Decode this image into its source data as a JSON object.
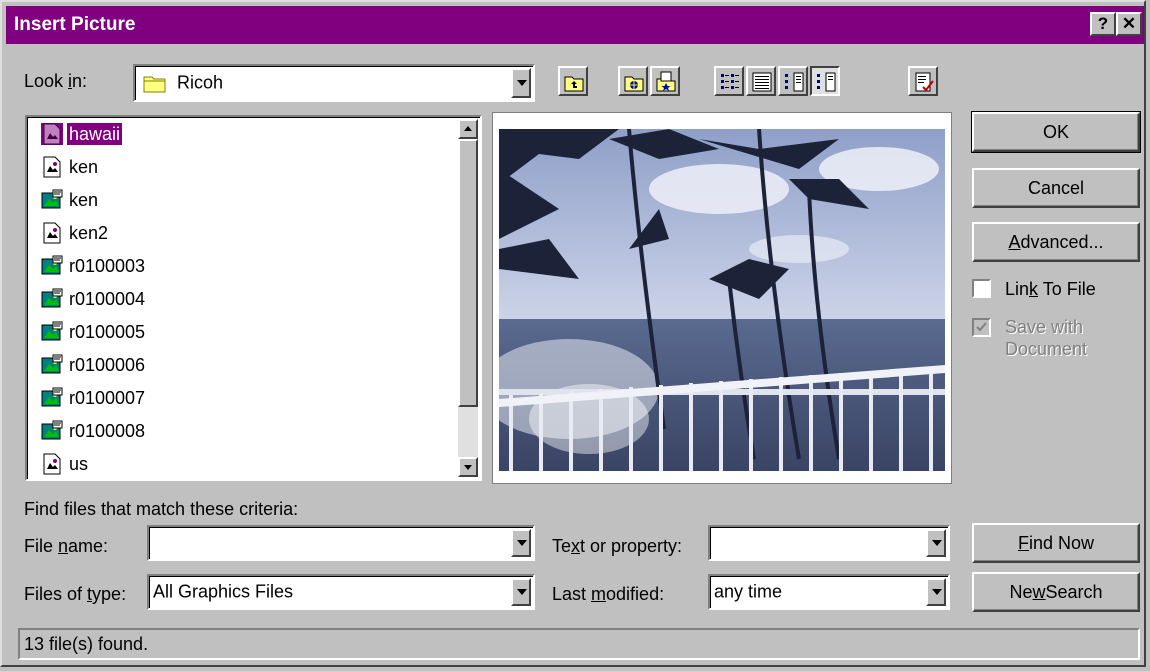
{
  "title": "Insert Picture",
  "titlebar_buttons": {
    "help": "?",
    "close": "✕"
  },
  "look_in": {
    "label_pre": "Look ",
    "label_u": "i",
    "label_post": "n:",
    "value": "Ricoh"
  },
  "toolbar": [
    "up-one-level-icon",
    "search-the-web-icon",
    "add-to-favorites-icon",
    "list-view-icon",
    "details-view-icon",
    "properties-view-icon",
    "preview-view-icon",
    "commands-and-settings-icon"
  ],
  "files": [
    {
      "name": "hawaii",
      "type": "picture",
      "selected": true
    },
    {
      "name": "ken",
      "type": "picture"
    },
    {
      "name": "ken",
      "type": "graphic"
    },
    {
      "name": "ken2",
      "type": "picture"
    },
    {
      "name": "r0100003",
      "type": "graphic"
    },
    {
      "name": "r0100004",
      "type": "graphic"
    },
    {
      "name": "r0100005",
      "type": "graphic"
    },
    {
      "name": "r0100006",
      "type": "graphic"
    },
    {
      "name": "r0100007",
      "type": "graphic"
    },
    {
      "name": "r0100008",
      "type": "graphic"
    },
    {
      "name": "us",
      "type": "picture"
    }
  ],
  "buttons": {
    "ok": "OK",
    "cancel": "Cancel",
    "advanced_u": "A",
    "advanced_rest": "dvanced...",
    "find_now_u": "F",
    "find_now_rest": "ind Now",
    "new_search_pre": "Ne",
    "new_search_u": "w",
    "new_search_post": " Search"
  },
  "options": {
    "link_pre": "Lin",
    "link_u": "k",
    "link_post": " To File",
    "link_checked": false,
    "save_line1": "Save with",
    "save_line2": "Document",
    "save_checked": true,
    "save_disabled": true
  },
  "criteria": {
    "heading": "Find files that match these criteria:",
    "file_name_pre": "File ",
    "file_name_u": "n",
    "file_name_post": "ame:",
    "file_name_value": "",
    "files_of_type_pre": "Files of ",
    "files_of_type_u": "t",
    "files_of_type_post": "ype:",
    "files_of_type_value": "All Graphics Files",
    "text_pre": "Te",
    "text_u": "x",
    "text_post": "t or property:",
    "text_value": "",
    "last_mod_pre": "Last ",
    "last_mod_u": "m",
    "last_mod_post": "odified:",
    "last_mod_value": "any time"
  },
  "status": "13 file(s) found."
}
